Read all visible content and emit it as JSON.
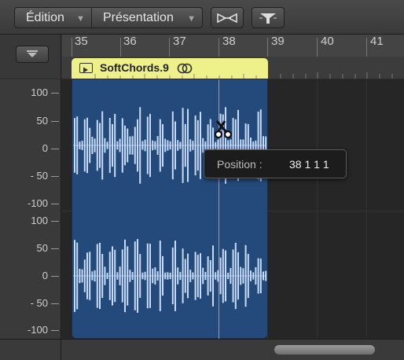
{
  "toolbar": {
    "edit_menu": "Édition",
    "view_menu": "Présentation",
    "tool_a_icon": "bounce-icon",
    "tool_b_icon": "funnel-flag-icon"
  },
  "ruler": {
    "bars": [
      "35",
      "36",
      "37",
      "38",
      "39",
      "40",
      "41"
    ],
    "collapse_icon": "triangle-down-icon"
  },
  "region": {
    "name": "SoftChords.9",
    "color": "#244a7c",
    "header_color": "#eef08a",
    "waveform_color": "#c8dcff"
  },
  "amplitude_scale": {
    "top_channel": [
      "100",
      "50",
      "0",
      "- 50",
      "-100"
    ],
    "bottom_channel": [
      "100",
      "50",
      "0",
      "- 50",
      "-100"
    ]
  },
  "tooltip": {
    "label": "Position :",
    "value": "38 1 1 1"
  }
}
